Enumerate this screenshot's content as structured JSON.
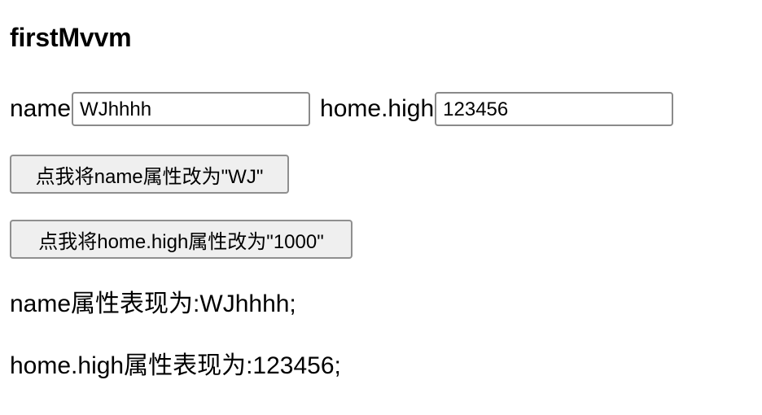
{
  "app": {
    "title": "firstMvvm"
  },
  "form": {
    "name_label": "name",
    "name_value": "WJhhhh",
    "high_label": "home.high",
    "high_value": "123456"
  },
  "buttons": {
    "set_name_label": "点我将name属性改为\"WJ\"",
    "set_high_label": "点我将home.high属性改为\"1000\""
  },
  "output": {
    "name_line": "name属性表现为:WJhhhh;",
    "high_line": "home.high属性表现为:123456;"
  }
}
